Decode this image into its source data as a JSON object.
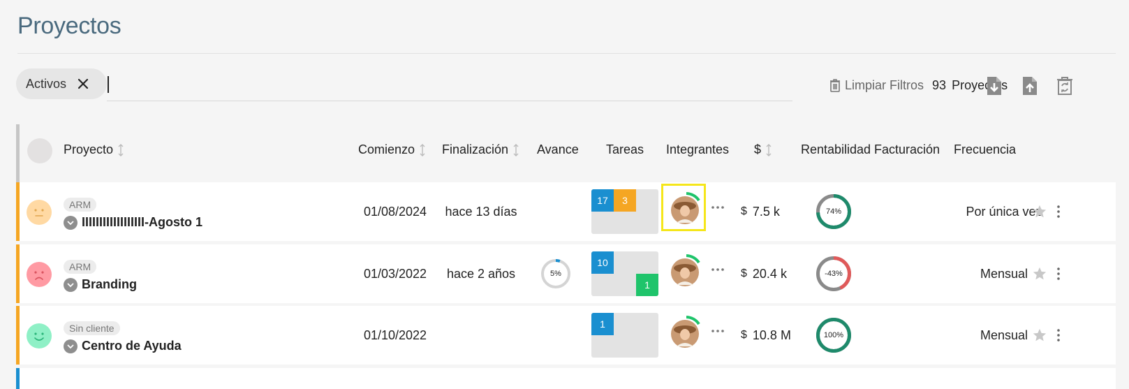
{
  "page": {
    "title": "Proyectos"
  },
  "filters": {
    "chip_label": "Activos",
    "search_value": "",
    "clear_label": "Limpiar Filtros",
    "count": "93",
    "count_label": "Proyectos"
  },
  "toolbar_icons": [
    "download-icon",
    "upload-icon",
    "recycle-bin-icon"
  ],
  "columns": {
    "project": "Proyecto",
    "start": "Comienzo",
    "end": "Finalización",
    "progress": "Avance",
    "tasks": "Tareas",
    "members": "Integrantes",
    "money": "$",
    "profitability": "Rentabilidad",
    "billing": "Facturación",
    "frequency": "Frecuencia"
  },
  "rows": [
    {
      "client": "ARM",
      "name": "IIIIIIIIIIIIIIIIII-Agosto 1",
      "mood": "neutral",
      "accent": "#f5a623",
      "start": "01/08/2024",
      "end": "hace 13 días",
      "progress_label": "",
      "tasks": {
        "blue": "17",
        "orange": "3",
        "green": ""
      },
      "money_symbol": "$",
      "money": "7.5 k",
      "profit_label": "74%",
      "profit_value": 74,
      "billing": "",
      "frequency": "Por única vez"
    },
    {
      "client": "ARM",
      "name": "Branding",
      "mood": "sad",
      "accent": "#f5a623",
      "start": "01/03/2022",
      "end": "hace 2 años",
      "progress_label": "5%",
      "progress_value": 5,
      "tasks": {
        "blue": "10",
        "orange": "",
        "green": "1"
      },
      "money_symbol": "$",
      "money": "20.4 k",
      "profit_label": "-43%",
      "profit_value": -43,
      "billing": "",
      "frequency": "Mensual"
    },
    {
      "client": "Sin cliente",
      "name": "Centro de Ayuda",
      "mood": "happy",
      "accent": "#f5a623",
      "start": "01/10/2022",
      "end": "",
      "progress_label": "",
      "tasks": {
        "blue": "1",
        "orange": "",
        "green": ""
      },
      "money_symbol": "$",
      "money": "10.8 M",
      "profit_label": "100%",
      "profit_value": 100,
      "billing": "",
      "frequency": "Mensual"
    }
  ],
  "colors": {
    "accent": "#f5a623",
    "task_blue": "#1a8fd0",
    "task_orange": "#f5a623",
    "task_green": "#1fc46b",
    "ring_green": "#1e8a6b",
    "ring_red": "#e05a5a",
    "highlight": "#f5e61a"
  }
}
